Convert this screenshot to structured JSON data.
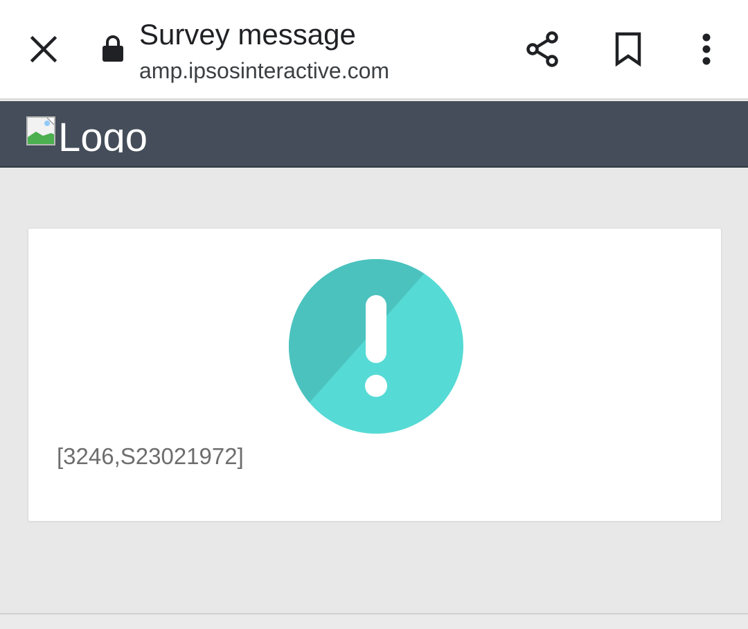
{
  "browser": {
    "close_icon": "close-icon",
    "lock_icon": "lock-icon",
    "title": "Survey message",
    "url": "amp.ipsosinteractive.com",
    "share_icon": "share-icon",
    "bookmark_icon": "bookmark-icon",
    "menu_icon": "more-vert-icon"
  },
  "site_header": {
    "logo_alt": "Logo",
    "background_color": "#444d59"
  },
  "message_card": {
    "alert_icon": "exclamation-circle-icon",
    "alert_color": "#56dad5",
    "error_code": "[3246,S23021972]"
  }
}
